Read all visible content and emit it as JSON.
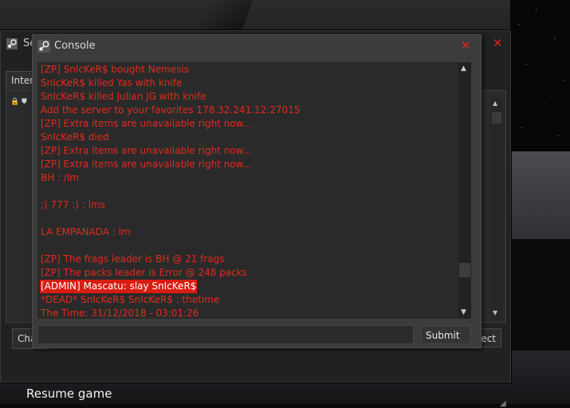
{
  "back_window": {
    "title": "Se",
    "tab_label": "Inter",
    "left_button": "Cha",
    "right_button": "ect"
  },
  "console": {
    "title": "Console",
    "lines": [
      {
        "text": "[ZP] SnIcKeR$ bought Nemesis",
        "highlight": false
      },
      {
        "text": "SnIcKeR$ killed Yas with knife",
        "highlight": false
      },
      {
        "text": "SnIcKeR$ killed Julian JG with knife",
        "highlight": false
      },
      {
        "text": "Add the server to your favorites 178.32.241.12:27015",
        "highlight": false
      },
      {
        "text": "[ZP] Extra items are unavailable right now...",
        "highlight": false
      },
      {
        "text": "SnIcKeR$ died",
        "highlight": false
      },
      {
        "text": "[ZP] Extra items are unavailable right now...",
        "highlight": false
      },
      {
        "text": "[ZP] Extra items are unavailable right now...",
        "highlight": false
      },
      {
        "text": "BH :  /lm",
        "highlight": false
      },
      {
        "text": "",
        "highlight": false
      },
      {
        "text": ";) 777 :) :  lms",
        "highlight": false
      },
      {
        "text": "",
        "highlight": false
      },
      {
        "text": "LA EMPANADA :  lm",
        "highlight": false
      },
      {
        "text": "",
        "highlight": false
      },
      {
        "text": "[ZP] The frags leader is BH @ 21 frags",
        "highlight": false
      },
      {
        "text": "[ZP] The packs leader is Error @ 248 packs",
        "highlight": false
      },
      {
        "text": "[ADMIN] Mascatu: slay SnIcKeR$",
        "highlight": true
      },
      {
        "text": "*DEAD* SnIcKeR$ SnIcKeR$ :  thetime",
        "highlight": false
      },
      {
        "text": "The Time:  31/12/2018 - 03:01:26",
        "highlight": false
      }
    ],
    "input_value": "",
    "submit_label": "Submit"
  },
  "resume_label": "Resume game",
  "colors": {
    "log_text": "#e12a1f",
    "highlight_bg": "#d81d12",
    "close_icon": "#e0201e"
  }
}
